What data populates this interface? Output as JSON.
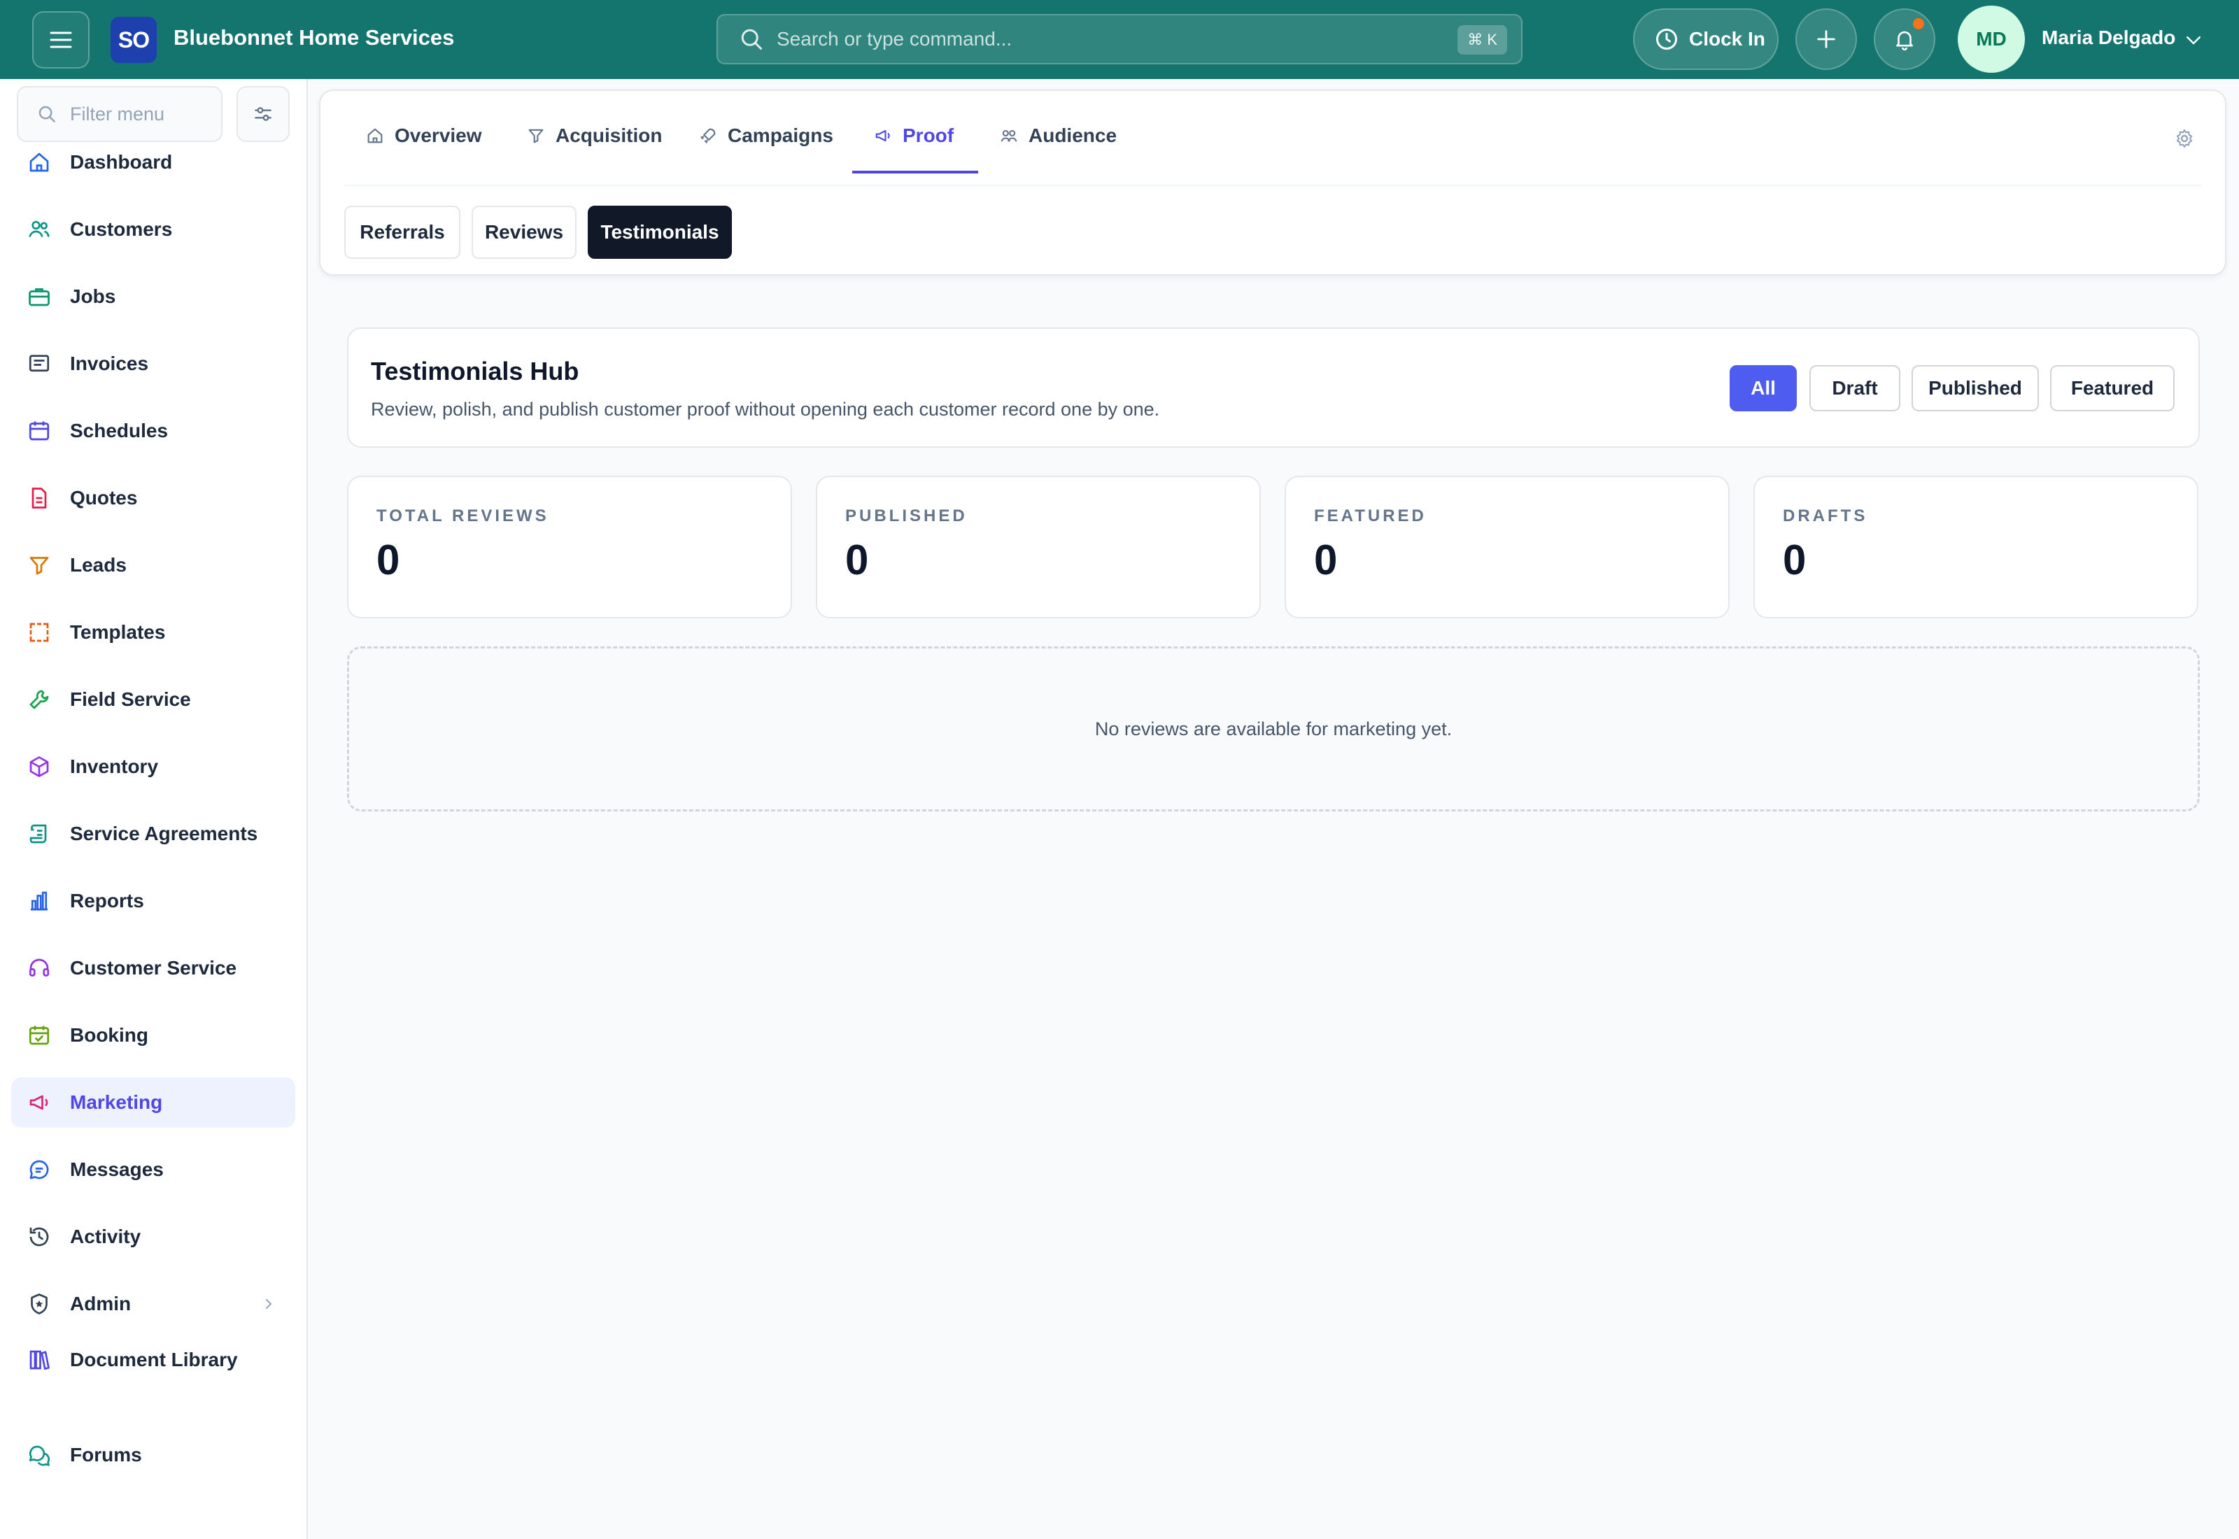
{
  "app": {
    "logo_text": "SO",
    "brand_name": "Bluebonnet Home Services"
  },
  "search": {
    "placeholder": "Search or type command...",
    "shortcut": "⌘ K"
  },
  "header": {
    "clock_in_label": "Clock In",
    "user_initials": "MD",
    "user_name": "Maria Delgado",
    "notification_dot_color": "#f97316"
  },
  "sidebar": {
    "filter_placeholder": "Filter menu",
    "items": [
      {
        "label": "Dashboard",
        "icon": "home-icon",
        "color": "#2563eb"
      },
      {
        "label": "Customers",
        "icon": "users-icon",
        "color": "#0d9488"
      },
      {
        "label": "Jobs",
        "icon": "briefcase-icon",
        "color": "#059669"
      },
      {
        "label": "Invoices",
        "icon": "invoice-icon",
        "color": "#334155"
      },
      {
        "label": "Schedules",
        "icon": "calendar-icon",
        "color": "#4f46e5"
      },
      {
        "label": "Quotes",
        "icon": "document-icon",
        "color": "#e11d48"
      },
      {
        "label": "Leads",
        "icon": "funnel-icon",
        "color": "#d97706"
      },
      {
        "label": "Templates",
        "icon": "template-icon",
        "color": "#ea580c"
      },
      {
        "label": "Field Service",
        "icon": "wrench-icon",
        "color": "#16a34a"
      },
      {
        "label": "Inventory",
        "icon": "box-icon",
        "color": "#9333ea"
      },
      {
        "label": "Service Agreements",
        "icon": "scroll-icon",
        "color": "#0d9488"
      },
      {
        "label": "Reports",
        "icon": "bar-chart-icon",
        "color": "#2563eb"
      },
      {
        "label": "Customer Service",
        "icon": "headset-icon",
        "color": "#9333ea"
      },
      {
        "label": "Booking",
        "icon": "calendar-check-icon",
        "color": "#65a30d"
      },
      {
        "label": "Marketing",
        "icon": "megaphone-icon",
        "color": "#db2777"
      },
      {
        "label": "Messages",
        "icon": "chat-icon",
        "color": "#2563eb"
      },
      {
        "label": "Activity",
        "icon": "history-icon",
        "color": "#334155"
      },
      {
        "label": "Admin",
        "icon": "shield-icon",
        "color": "#334155"
      },
      {
        "label": "Document Library",
        "icon": "library-icon",
        "color": "#4f46e5"
      },
      {
        "label": "Forums",
        "icon": "forum-icon",
        "color": "#0d9488"
      }
    ],
    "active_item": "Marketing"
  },
  "tabs": [
    {
      "label": "Overview"
    },
    {
      "label": "Acquisition"
    },
    {
      "label": "Campaigns"
    },
    {
      "label": "Proof"
    },
    {
      "label": "Audience"
    }
  ],
  "active_tab": "Proof",
  "subtabs": [
    {
      "label": "Referrals"
    },
    {
      "label": "Reviews"
    },
    {
      "label": "Testimonials"
    }
  ],
  "active_subtab": "Testimonials",
  "hub": {
    "title": "Testimonials Hub",
    "subtitle": "Review, polish, and publish customer proof without opening each customer record one by one.",
    "filters": [
      "All",
      "Draft",
      "Published",
      "Featured"
    ],
    "active_filter": "All"
  },
  "stats": [
    {
      "label": "TOTAL REVIEWS",
      "value": "0"
    },
    {
      "label": "PUBLISHED",
      "value": "0"
    },
    {
      "label": "FEATURED",
      "value": "0"
    },
    {
      "label": "DRAFTS",
      "value": "0"
    }
  ],
  "empty_state": "No reviews are available for marketing yet.",
  "colors": {
    "topbar": "#14756e",
    "accent": "#4f46e5",
    "pill_active": "#4f5cf0",
    "subtab_active": "#111827"
  }
}
